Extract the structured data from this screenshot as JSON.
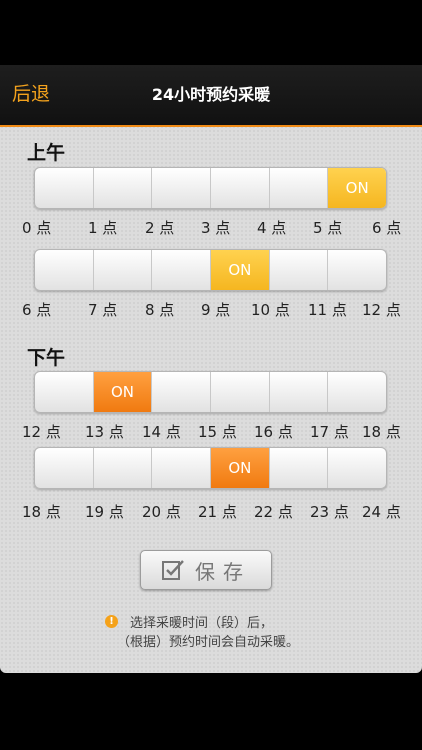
{
  "header": {
    "back_label": "后退",
    "title": "24小时预约采暖"
  },
  "morning": {
    "label": "上午"
  },
  "afternoon": {
    "label": "下午"
  },
  "rows": [
    {
      "on_index": 5,
      "on_label": "ON",
      "on_color": "#f5b620",
      "ticks": [
        "0 点",
        "1 点",
        "2 点",
        "3 点",
        "4 点",
        "5 点",
        "6 点"
      ]
    },
    {
      "on_index": 3,
      "on_label": "ON",
      "on_color": "#f5b620",
      "ticks": [
        "6 点",
        "7 点",
        "8 点",
        "9 点",
        "10 点",
        "11 点",
        "12 点"
      ]
    },
    {
      "on_index": 1,
      "on_label": "ON",
      "on_color": "#f07a10",
      "ticks": [
        "12 点",
        "13 点",
        "14 点",
        "15 点",
        "16 点",
        "17 点",
        "18 点"
      ]
    },
    {
      "on_index": 3,
      "on_label": "ON",
      "on_color": "#f07a10",
      "ticks": [
        "18 点",
        "19 点",
        "20 点",
        "21 点",
        "22 点",
        "23 点",
        "24 点"
      ]
    }
  ],
  "save": {
    "label": "保存",
    "icon": "checkbox-icon"
  },
  "note": {
    "icon": "warning-icon",
    "line1": "选择采暖时间（段）后，",
    "line2": "（根据）预约时间会自动采暖。"
  }
}
